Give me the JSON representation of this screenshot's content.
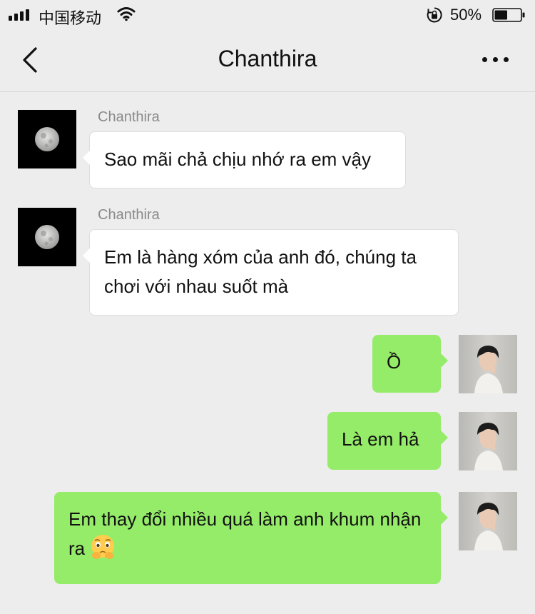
{
  "status_bar": {
    "carrier": "中国移动",
    "battery_percent": "50%",
    "battery_level": 0.5,
    "signal_icon": "signal-bars-icon",
    "wifi_icon": "wifi-icon",
    "lock_icon": "rotation-lock-icon"
  },
  "header": {
    "title": "Chanthira",
    "back_icon": "chevron-left-icon",
    "more_icon": "more-dots-icon"
  },
  "messages": [
    {
      "side": "incoming",
      "sender": "Chanthira",
      "text": "Sao mãi chả chịu nhớ ra em vậy"
    },
    {
      "side": "incoming",
      "sender": "Chanthira",
      "text": "Em là hàng xóm của anh đó, chúng ta chơi với nhau suốt mà"
    },
    {
      "side": "outgoing",
      "text": "Ồ"
    },
    {
      "side": "outgoing",
      "text": "Là em hả"
    },
    {
      "side": "outgoing",
      "text": "Em thay đổi nhiều quá làm anh khum nhận ra",
      "emoji": "pleading-face-hands-emoji"
    }
  ],
  "colors": {
    "background": "#ededed",
    "outgoing_bubble": "#95ec69",
    "incoming_bubble": "#ffffff",
    "sender_name": "#8a8a8a"
  }
}
